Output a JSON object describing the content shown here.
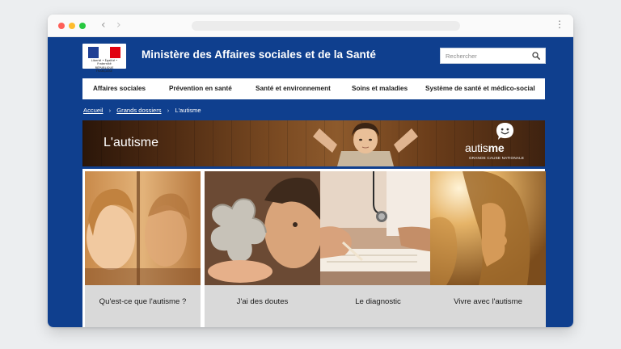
{
  "browser": {
    "back_icon": "chevron-left-icon",
    "forward_icon": "chevron-right-icon",
    "menu_icon": "kebab-menu-icon"
  },
  "header": {
    "logo_lines": [
      "Liberté • Égalité • Fraternité",
      "RÉPUBLIQUE FRANÇAISE"
    ],
    "title": "Ministère des Affaires sociales et de la Santé",
    "search": {
      "placeholder": "Rechercher",
      "icon": "search-icon"
    },
    "colors": {
      "brand_blue": "#0f3f8e",
      "flag_blue": "#1f3f94",
      "flag_red": "#e1000f"
    }
  },
  "nav": {
    "items": [
      {
        "label": "Affaires sociales"
      },
      {
        "label": "Prévention en santé"
      },
      {
        "label": "Santé et environnement"
      },
      {
        "label": "Soins et maladies"
      },
      {
        "label": "Système de santé et médico-social"
      }
    ]
  },
  "breadcrumb": {
    "items": [
      {
        "label": "Accueil"
      },
      {
        "label": "Grands dossiers"
      },
      {
        "label": "L'autisme"
      }
    ],
    "separator": "›"
  },
  "banner": {
    "title": "L'autisme",
    "badge_word_a": "autis",
    "badge_word_b": "me",
    "badge_subtitle": "GRANDE CAUSE NATIONALE"
  },
  "tiles": [
    {
      "label": "Qu'est-ce que l'autisme ?"
    },
    {
      "label": "J'ai des doutes"
    },
    {
      "label": "Le diagnostic"
    },
    {
      "label": "Vivre avec l'autisme"
    }
  ]
}
